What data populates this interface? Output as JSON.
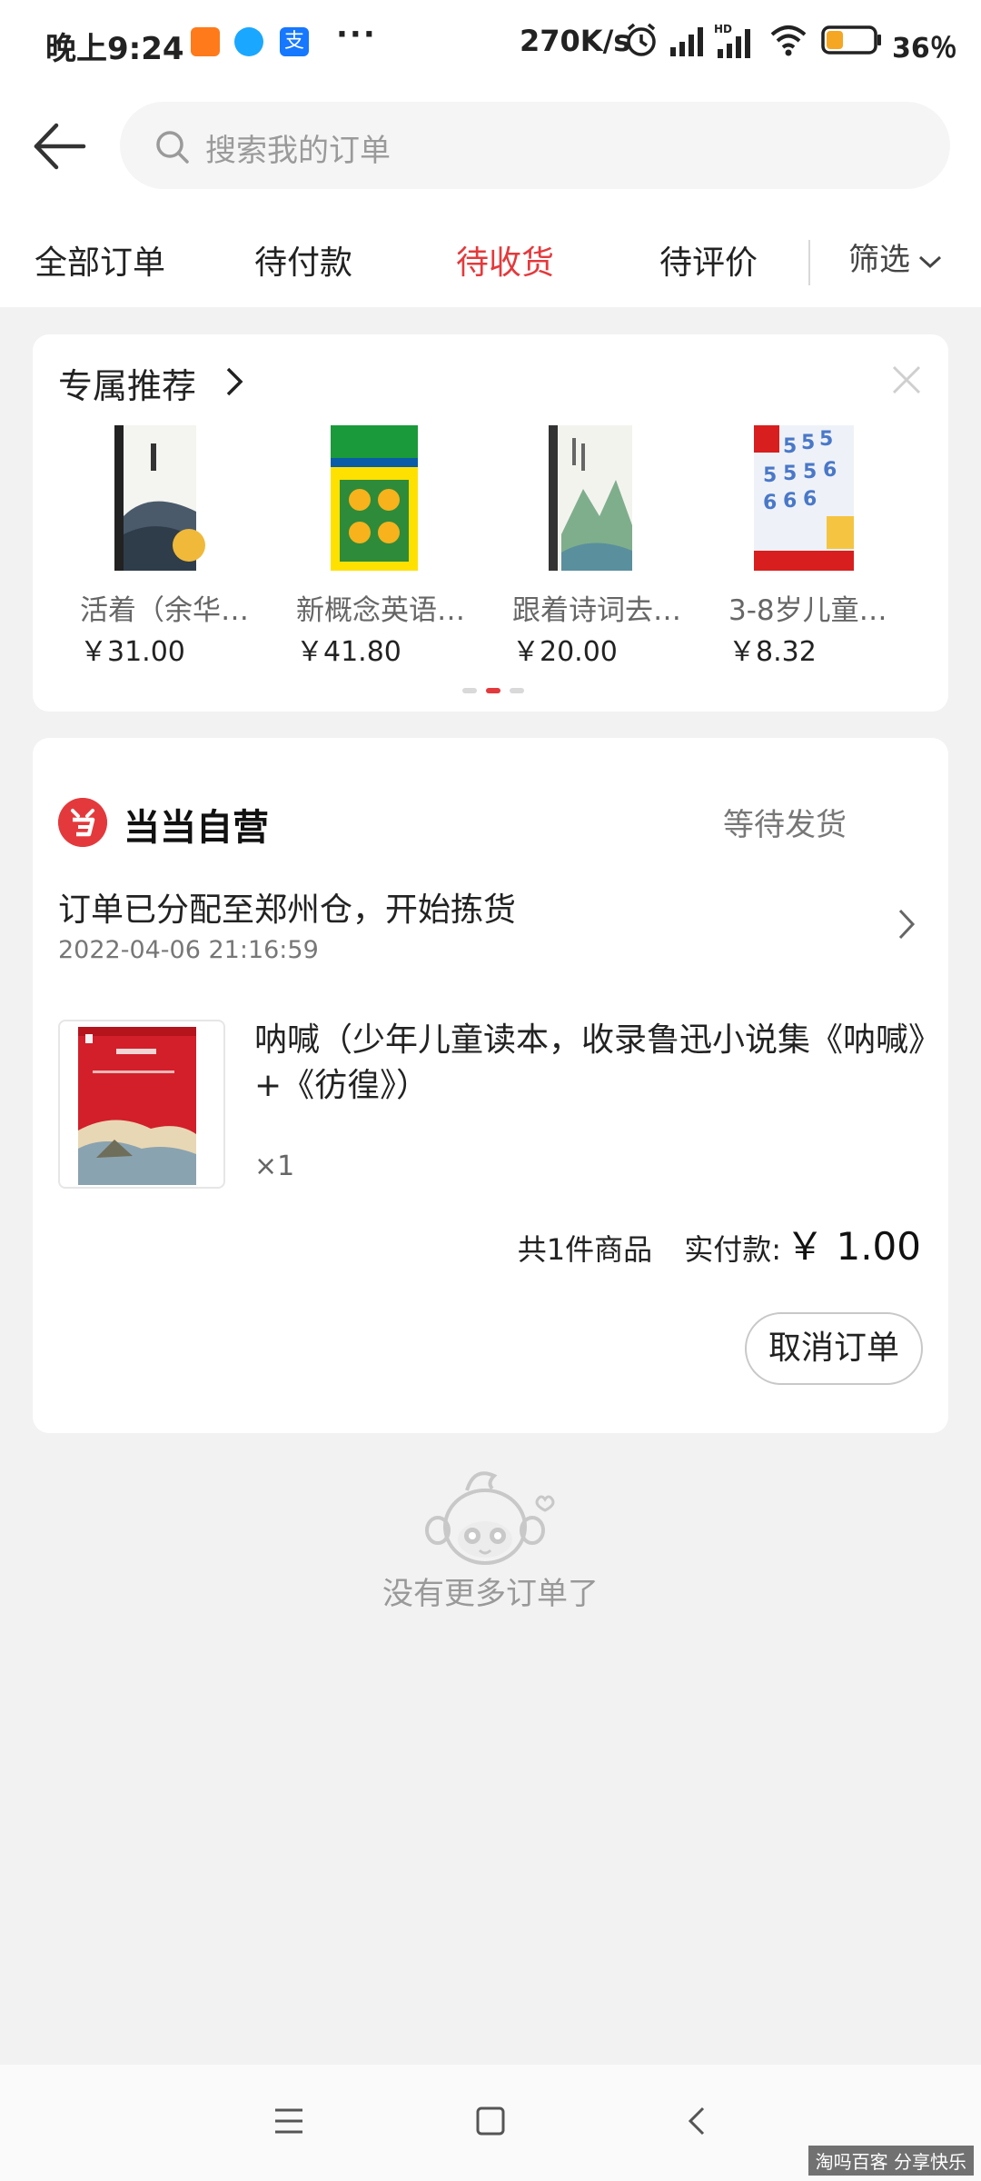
{
  "status_bar": {
    "time": "晚上9:24",
    "alipay_glyph": "支",
    "more": "···",
    "net_speed": "270K/s",
    "battery": "36％",
    "battery_level": 0.36,
    "icons": [
      "alarm-icon",
      "signal-icon",
      "hd-signal-icon",
      "wifi-icon",
      "battery-icon"
    ]
  },
  "header": {
    "search_placeholder": "搜索我的订单"
  },
  "tabs": {
    "items": [
      "全部订单",
      "待付款",
      "待收货",
      "待评价"
    ],
    "active": "待收货",
    "filter_label": "筛选"
  },
  "recommend": {
    "title": "专属推荐",
    "items": [
      {
        "name": "活着（余华…",
        "price": "￥31.00"
      },
      {
        "name": "新概念英语…",
        "price": "￥41.80"
      },
      {
        "name": "跟着诗词去…",
        "price": "￥20.00"
      },
      {
        "name": "3-8岁儿童…",
        "price": "￥8.32"
      }
    ],
    "page_count": 3,
    "active_page": 2
  },
  "order": {
    "shop_name": "当当自营",
    "status": "等待发货",
    "logistics": "订单已分配至郑州仓，开始拣货",
    "logistics_time": "2022-04-06 21:16:59",
    "product_title": "呐喊（少年儿童读本，收录鲁迅小说集《呐喊》+《彷徨》）",
    "quantity": "×1",
    "item_count": "共1件商品",
    "paid_label": "实付款:",
    "paid_amount": "￥ 1.00",
    "cancel_label": "取消订单"
  },
  "empty_text": "没有更多订单了",
  "watermark": "淘吗百客 分享快乐",
  "colors": {
    "accent": "#e4393c",
    "background": "#f2f2f2",
    "card": "#ffffff"
  }
}
